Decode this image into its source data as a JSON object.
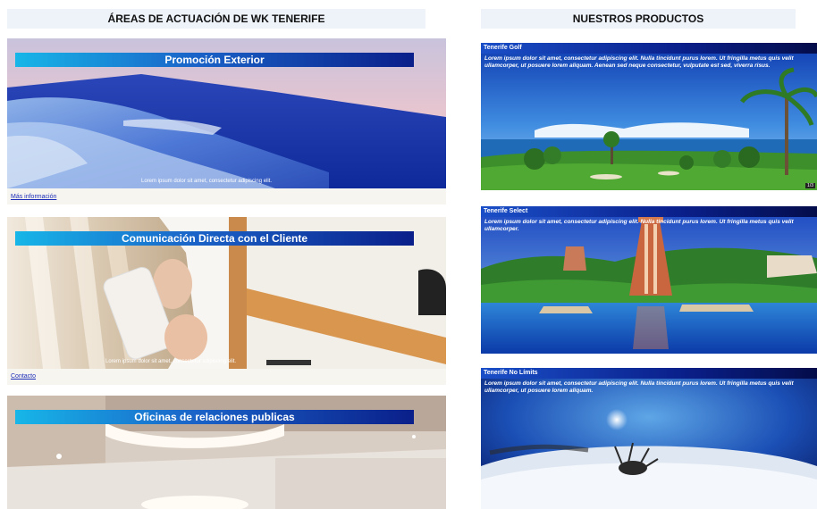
{
  "headers": {
    "areas": "ÁREAS DE ACTUACIÓN DE WK TENERIFE",
    "products": "NUESTROS PRODUCTOS"
  },
  "areas": [
    {
      "title": "Promoción Exterior",
      "caption": "Lorem ipsum dolor sit amet, consectetur adipiscing elit.",
      "link": "Más información"
    },
    {
      "title": "Comunicación Directa con el Cliente",
      "caption": "Lorem ipsum dolor sit amet, consectetur adipiscing elit.",
      "link": "Contacto"
    },
    {
      "title": "Oficinas de relaciones publicas"
    }
  ],
  "products": [
    {
      "title": "Tenerife Golf",
      "desc": "Lorem ipsum dolor sit amet, consectetur adipiscing elit. Nulla tincidunt purus lorem. Ut fringilla metus quis velit ullamcorper, ut posuere lorem aliquam. Aenean sed neque consectetur, vulputate est sed, viverra risus.",
      "badge": "1/3"
    },
    {
      "title": "Tenerife Select",
      "desc": "Lorem ipsum dolor sit amet, consectetur adipiscing elit. Nulla tincidunt purus lorem. Ut fringilla metus quis velit ullamcorper."
    },
    {
      "title": "Tenerife No Límits",
      "desc": "Lorem ipsum dolor sit amet, consectetur adipiscing elit. Nulla tincidunt purus lorem. Ut fringilla metus quis velit ullamcorper, ut posuere lorem aliquam."
    }
  ],
  "colors": {
    "banner_start": "#17b6e8",
    "banner_end": "#0a1f8a",
    "link": "#1b2db8",
    "header_bg": "#eef3fa"
  }
}
